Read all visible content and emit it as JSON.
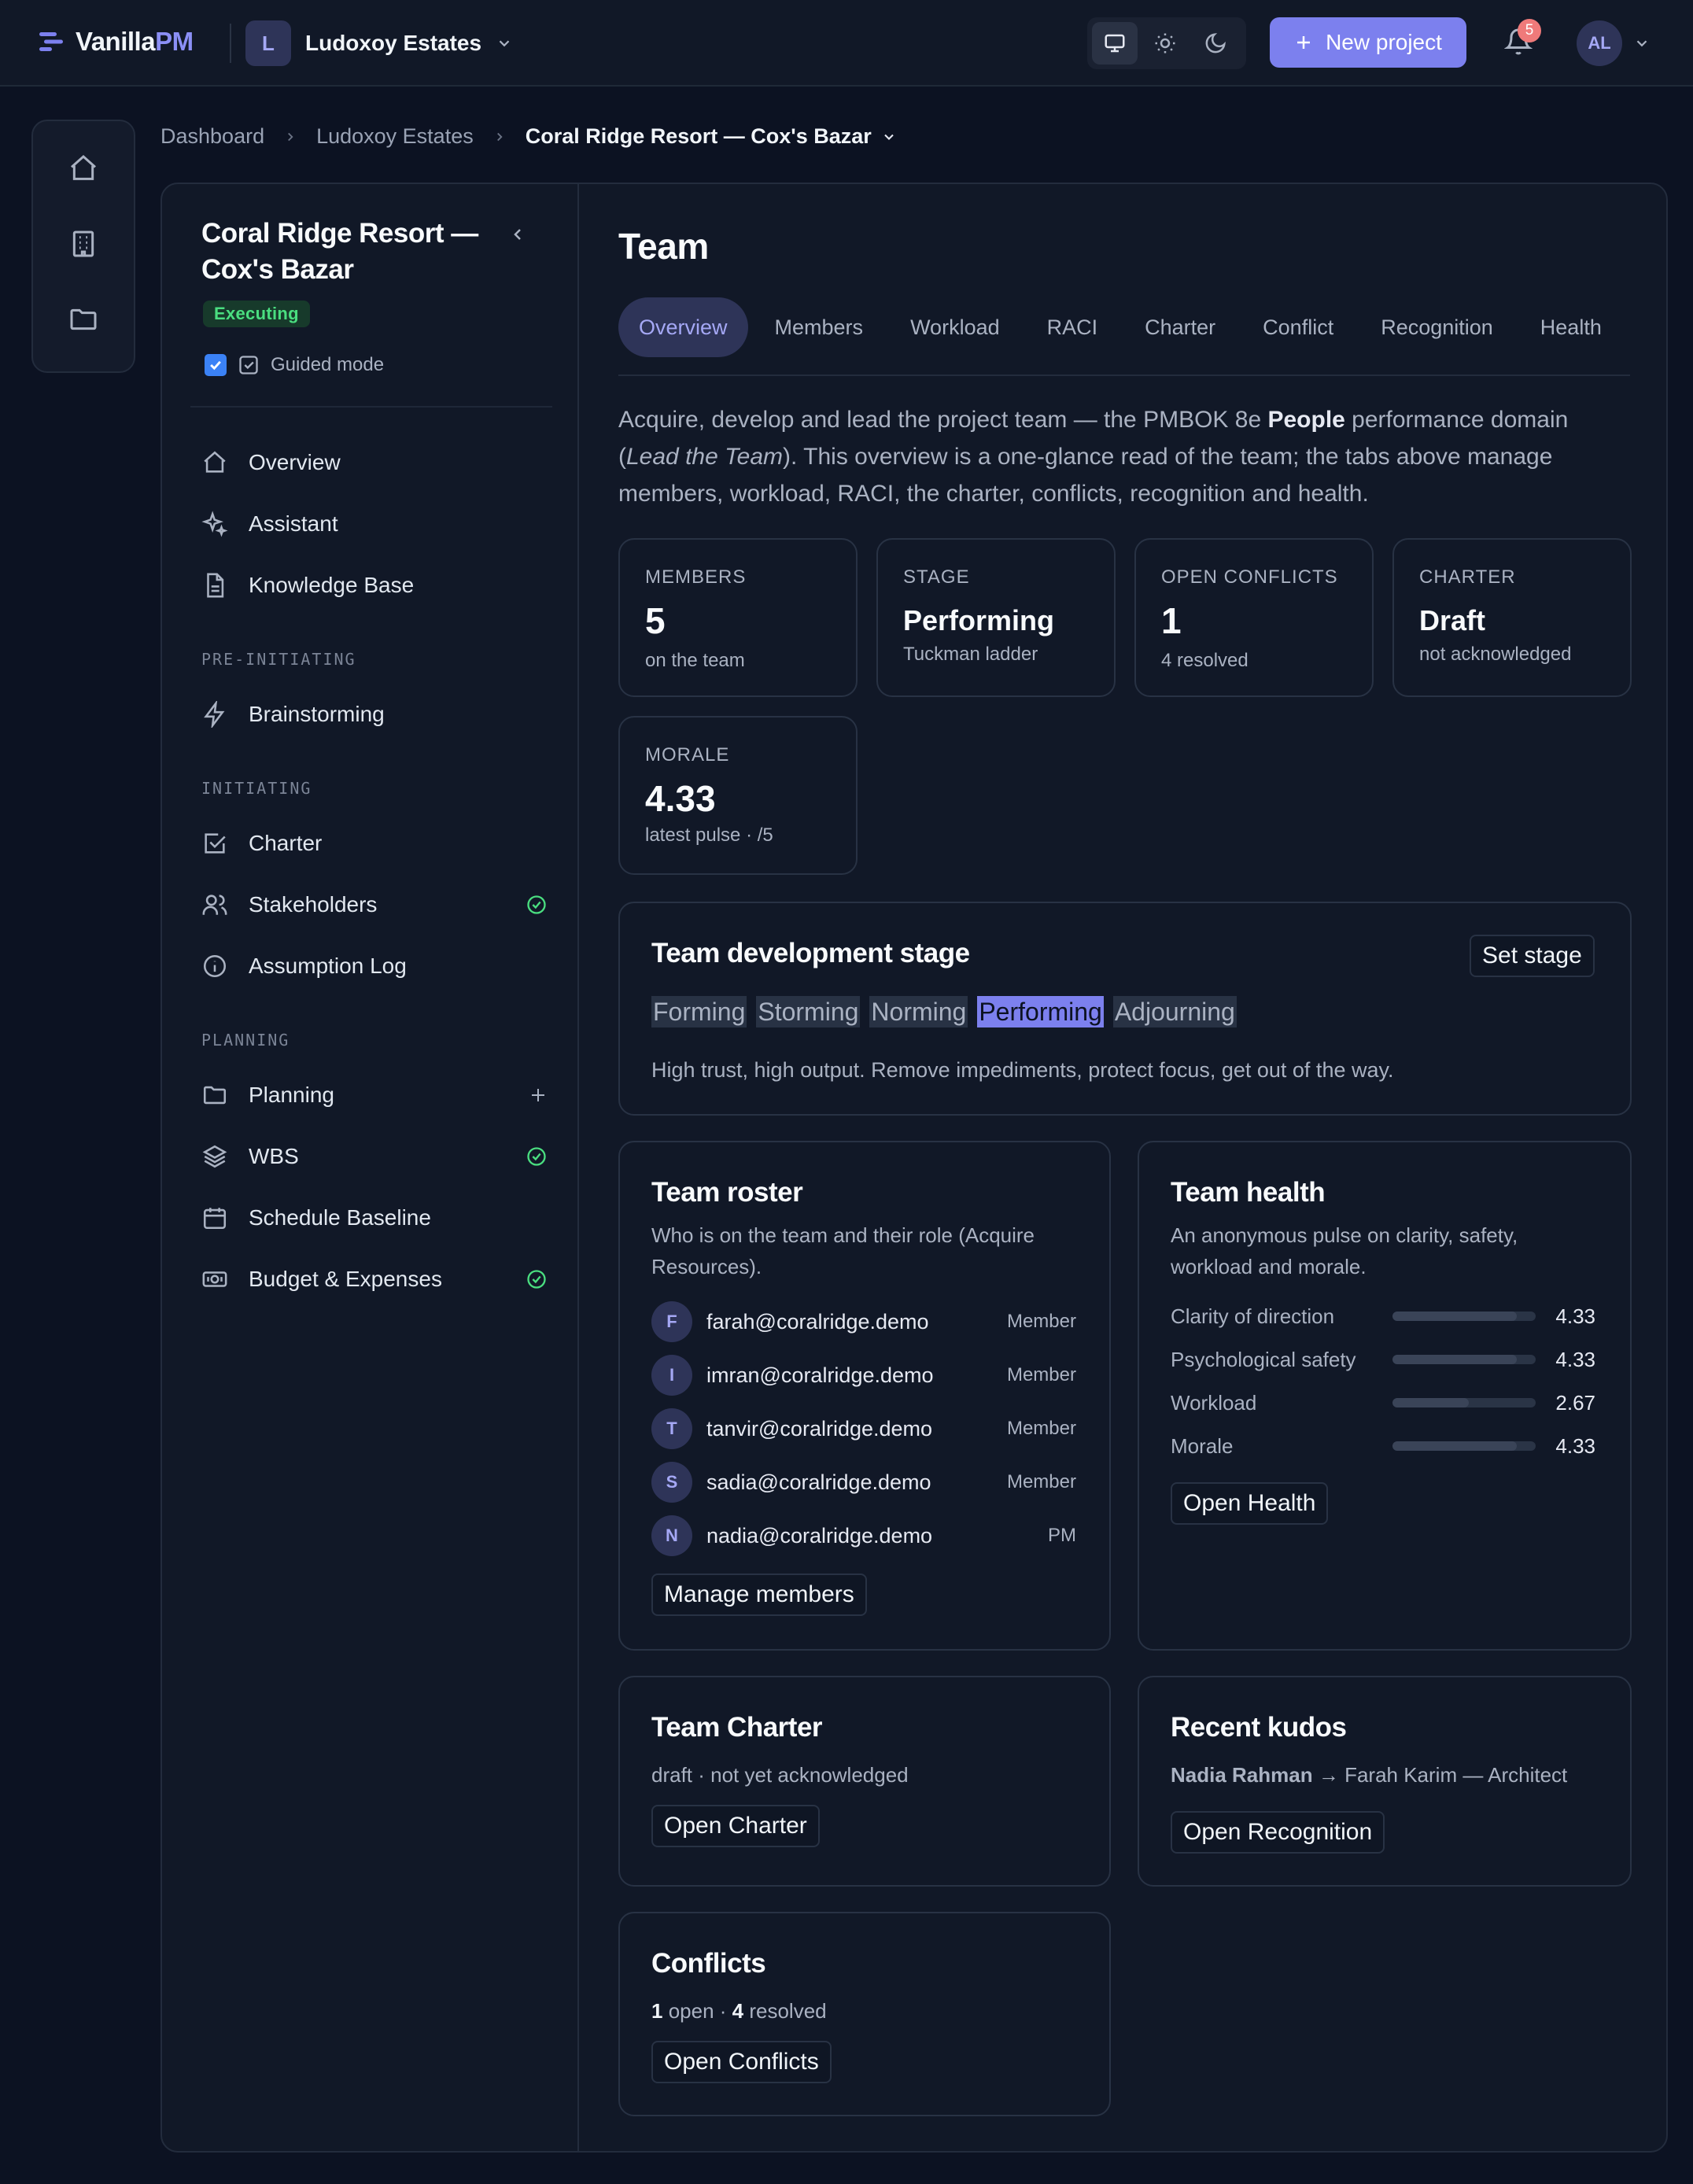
{
  "app": {
    "name_main": "Vanilla",
    "name_accent": "PM"
  },
  "org": {
    "initial": "L",
    "name": "Ludoxoy Estates"
  },
  "header": {
    "new_project_label": "New project",
    "notification_count": "5",
    "user_initials": "AL"
  },
  "breadcrumb": [
    "Dashboard",
    "Ludoxoy Estates",
    "Coral Ridge Resort — Cox's Bazar"
  ],
  "sidebar": {
    "project_title": "Coral Ridge Resort — Cox's Bazar",
    "status": "Executing",
    "guided_label": "Guided mode",
    "top_items": [
      {
        "label": "Overview",
        "icon": "home-icon"
      },
      {
        "label": "Assistant",
        "icon": "sparkles-icon"
      },
      {
        "label": "Knowledge Base",
        "icon": "document-icon"
      }
    ],
    "sections": [
      {
        "title": "PRE-INITIATING",
        "items": [
          {
            "label": "Brainstorming",
            "icon": "bolt-icon"
          }
        ]
      },
      {
        "title": "INITIATING",
        "items": [
          {
            "label": "Charter",
            "icon": "check-square-icon"
          },
          {
            "label": "Stakeholders",
            "icon": "users-icon",
            "done": true
          },
          {
            "label": "Assumption Log",
            "icon": "info-icon"
          }
        ]
      },
      {
        "title": "PLANNING",
        "items": [
          {
            "label": "Planning",
            "icon": "folder-icon",
            "add": true
          },
          {
            "label": "WBS",
            "icon": "layers-icon",
            "done": true
          },
          {
            "label": "Schedule Baseline",
            "icon": "calendar-icon"
          },
          {
            "label": "Budget & Expenses",
            "icon": "money-icon",
            "done": true
          }
        ]
      }
    ]
  },
  "main": {
    "title": "Team",
    "tabs": [
      "Overview",
      "Members",
      "Workload",
      "RACI",
      "Charter",
      "Conflict",
      "Recognition",
      "Health"
    ],
    "active_tab": 0,
    "intro": {
      "p1": "Acquire, develop and lead the project team — the PMBOK 8e ",
      "bold": "People",
      "p2": " performance domain (",
      "italic": "Lead the Team",
      "p3": "). This overview is a one-glance read of the team; the tabs above manage members, workload, RACI, the charter, conflicts, recognition and health."
    },
    "kpis": [
      {
        "label": "MEMBERS",
        "value": "5",
        "sub": "on the team"
      },
      {
        "label": "STAGE",
        "value": "Performing",
        "sub": "Tuckman ladder"
      },
      {
        "label": "OPEN CONFLICTS",
        "value": "1",
        "sub": "4 resolved"
      },
      {
        "label": "CHARTER",
        "value": "Draft",
        "sub": "not acknowledged"
      },
      {
        "label": "MORALE",
        "value": "4.33",
        "sub": "latest pulse · /5"
      }
    ],
    "stage_card": {
      "title": "Team development stage",
      "button": "Set stage",
      "stages": [
        "Forming",
        "Storming",
        "Norming",
        "Performing",
        "Adjourning"
      ],
      "active_stage": 3,
      "description": "High trust, high output. Remove impediments, protect focus, get out of the way."
    },
    "roster": {
      "title": "Team roster",
      "subtitle": "Who is on the team and their role (Acquire Resources).",
      "members": [
        {
          "initial": "F",
          "email": "farah@coralridge.demo",
          "role": "Member"
        },
        {
          "initial": "I",
          "email": "imran@coralridge.demo",
          "role": "Member"
        },
        {
          "initial": "T",
          "email": "tanvir@coralridge.demo",
          "role": "Member"
        },
        {
          "initial": "S",
          "email": "sadia@coralridge.demo",
          "role": "Member"
        },
        {
          "initial": "N",
          "email": "nadia@coralridge.demo",
          "role": "PM"
        }
      ],
      "button": "Manage members"
    },
    "health": {
      "title": "Team health",
      "subtitle": "An anonymous pulse on clarity, safety, workload and morale.",
      "metrics": [
        {
          "label": "Clarity of direction",
          "value": "4.33",
          "fraction": 0.866
        },
        {
          "label": "Psychological safety",
          "value": "4.33",
          "fraction": 0.866
        },
        {
          "label": "Workload",
          "value": "2.67",
          "fraction": 0.534
        },
        {
          "label": "Morale",
          "value": "4.33",
          "fraction": 0.866
        }
      ],
      "button": "Open Health"
    },
    "charter_card": {
      "title": "Team Charter",
      "subtitle": "draft · not yet acknowledged",
      "button": "Open Charter"
    },
    "kudos": {
      "title": "Recent kudos",
      "from": "Nadia Rahman",
      "arrow": " → ",
      "to": "Farah Karim — Architect",
      "button": "Open Recognition"
    },
    "conflicts": {
      "title": "Conflicts",
      "open": "1",
      "open_label": " open · ",
      "resolved": "4",
      "resolved_label": " resolved",
      "button": "Open Conflicts"
    }
  }
}
